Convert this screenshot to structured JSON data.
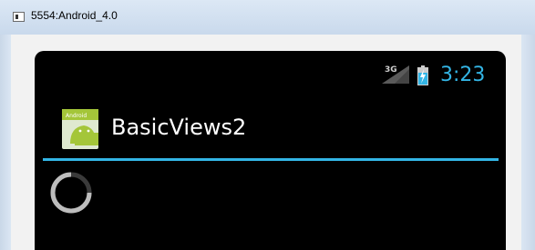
{
  "window": {
    "title": "5554:Android_4.0",
    "icon": "window-icon"
  },
  "status_bar": {
    "network_label": "3G",
    "network_icon": "signal-3g-icon",
    "battery_icon": "battery-charging-icon",
    "time": "3:23",
    "accent_color": "#33b5e5"
  },
  "action_bar": {
    "app_icon": "android-app-icon",
    "app_icon_label": "Android",
    "title": "BasicViews2",
    "divider_color": "#33b5e5"
  },
  "content": {
    "progress_indicator": "indeterminate-spinner"
  }
}
